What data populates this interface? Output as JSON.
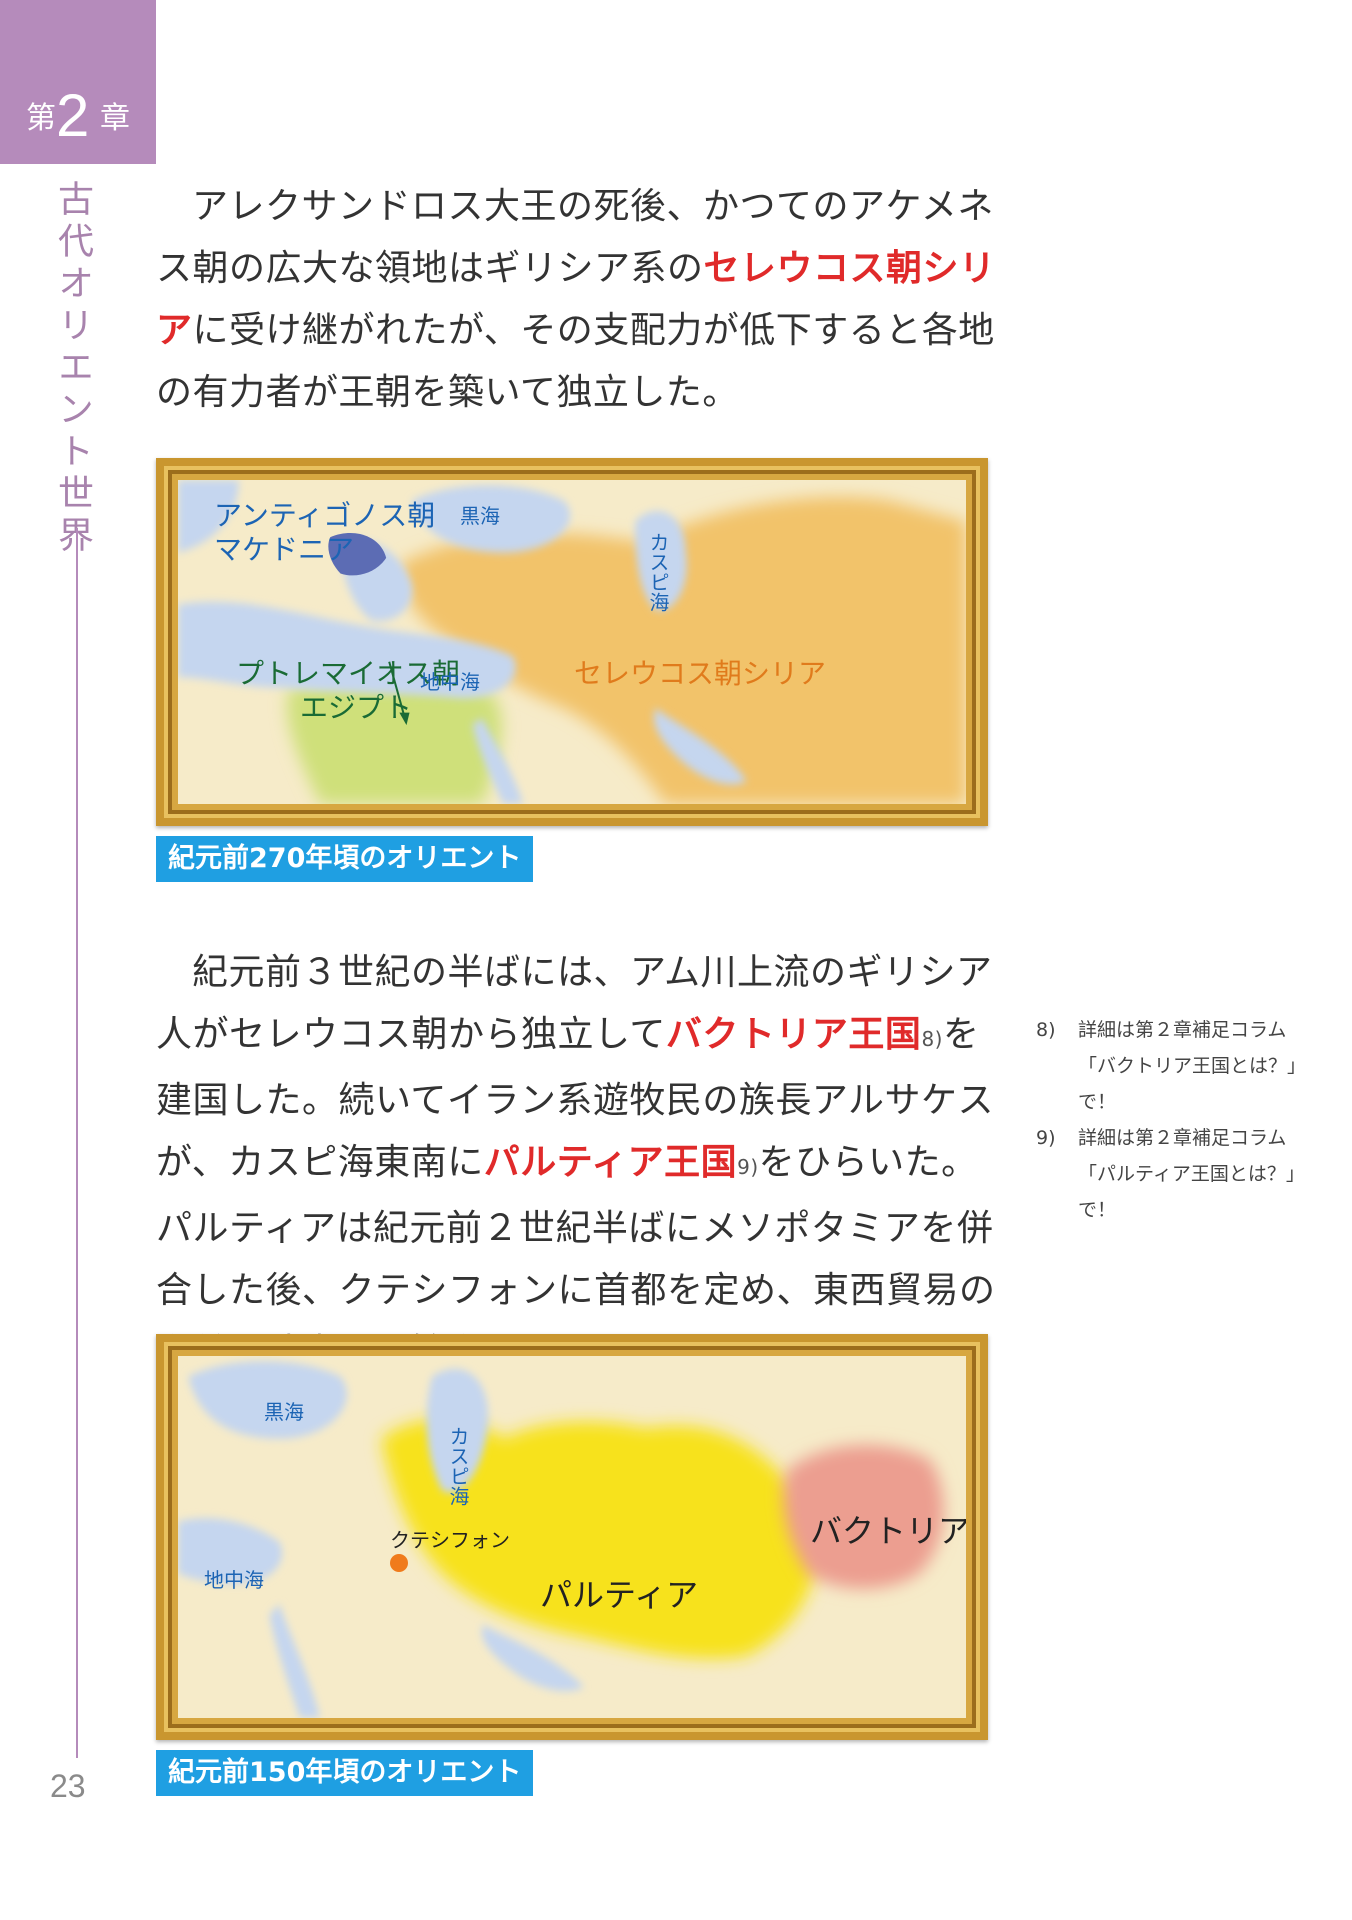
{
  "chapter": {
    "label_prefix": "第",
    "number": "2",
    "label_suffix": "章",
    "title": "古代オリエント世界"
  },
  "page_number": "23",
  "para1": {
    "t1": "アレクサンドロス大王の死後、かつてのアケメネス朝の広大な領地はギリシア系の",
    "hl": "セレウコス朝シリア",
    "t2": "に受け継がれたが、その支配力が低下すると各地の有力者が王朝を築いて独立した。"
  },
  "map1": {
    "labels": {
      "antigonid": "アンティゴノス朝",
      "macedonia": "マケドニア",
      "black_sea": "黒海",
      "caspian": "カスピ海",
      "ptolemaic": "プトレマイオス朝",
      "egypt": "エジプト",
      "mediterranean": "地中海",
      "seleucid": "セレウコス朝シリア"
    },
    "colors": {
      "sea": "#c5d6ef",
      "land": "#f6ebc9",
      "seleucid": "#f2c36b",
      "macedonia": "#5c6cb4",
      "egypt": "#cfe07a"
    }
  },
  "caption1": "紀元前270年頃のオリエント",
  "para2": {
    "t1": "紀元前３世紀の半ばには、アム川上流のギリシア人がセレウコス朝から独立して",
    "hl1": "バクトリア王国",
    "fn1": "8)",
    "t2": "を建国した。続いてイラン系遊牧民の族長アルサケスが、カスピ海東南に",
    "hl2": "パルティア王国",
    "fn2": "9)",
    "t3": "をひらいた。パルティアは紀元前２世紀半ばにメソポタミアを併合した後、クテシフォンに首都を定め、東西貿易の利益を独占して繁栄した。"
  },
  "footnotes": [
    {
      "num": "8)",
      "line1": "詳細は第２章補足コラム",
      "line2": "「バクトリア王国とは？」で！"
    },
    {
      "num": "9)",
      "line1": "詳細は第２章補足コラム",
      "line2": "「パルティア王国とは？」で！"
    }
  ],
  "map2": {
    "labels": {
      "black_sea": "黒海",
      "caspian": "カスピ海",
      "bactria": "バクトリア",
      "ctesiphon": "クテシフォン",
      "mediterranean": "地中海",
      "parthia": "パルティア"
    },
    "colors": {
      "sea": "#c5d6ef",
      "land": "#f6ebc9",
      "parthia": "#f7e21e",
      "bactria": "#ec9e90",
      "capital": "#f07b1c"
    }
  },
  "caption2": "紀元前150年頃のオリエント"
}
